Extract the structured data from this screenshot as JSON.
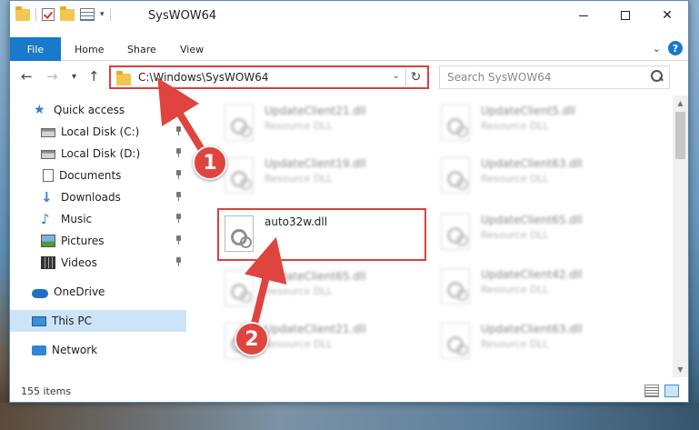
{
  "window": {
    "title": "SysWOW64",
    "controls": {
      "minimize": "—",
      "maximize": "",
      "close": "✕"
    }
  },
  "ribbon": {
    "file": "File",
    "tabs": [
      "Home",
      "Share",
      "View"
    ],
    "help": "?"
  },
  "nav": {
    "back": "←",
    "forward": "→",
    "recent": "▾",
    "up": "↑"
  },
  "address": {
    "path": "C:\\Windows\\SysWOW64",
    "dropdown": "⌄",
    "refresh": "↻"
  },
  "search": {
    "placeholder": "Search SysWOW64"
  },
  "sidebar": {
    "items": [
      {
        "label": "Quick access",
        "icon": "star-icon",
        "pinned": false
      },
      {
        "label": "Local Disk (C:)",
        "icon": "disk-icon",
        "pinned": true
      },
      {
        "label": "Local Disk (D:)",
        "icon": "disk-icon",
        "pinned": true
      },
      {
        "label": "Documents",
        "icon": "documents-icon",
        "pinned": true
      },
      {
        "label": "Downloads",
        "icon": "downloads-icon",
        "pinned": true
      },
      {
        "label": "Music",
        "icon": "music-icon",
        "pinned": true
      },
      {
        "label": "Pictures",
        "icon": "pictures-icon",
        "pinned": true
      },
      {
        "label": "Videos",
        "icon": "videos-icon",
        "pinned": true
      },
      {
        "label": "OneDrive",
        "icon": "onedrive-icon",
        "pinned": false
      },
      {
        "label": "This PC",
        "icon": "this-pc-icon",
        "pinned": false,
        "selected": true
      },
      {
        "label": "Network",
        "icon": "network-icon",
        "pinned": false
      }
    ]
  },
  "files": {
    "left": [
      {
        "name": "UpdateClient21.dll",
        "type": "Resource DLL",
        "blurred": true
      },
      {
        "name": "UpdateClient19.dll",
        "type": "Resource DLL",
        "blurred": true
      },
      {
        "name": "auto32w.dll",
        "type": "",
        "blurred": false
      },
      {
        "name": "UpdateClient65.dll",
        "type": "Resource DLL",
        "blurred": true
      },
      {
        "name": "UpdateClient21.dll",
        "type": "Resource DLL",
        "blurred": true
      }
    ],
    "right": [
      {
        "name": "UpdateClient5.dll",
        "type": "Resource DLL",
        "blurred": true
      },
      {
        "name": "UpdateClient63.dll",
        "type": "Resource DLL",
        "blurred": true
      },
      {
        "name": "UpdateClient65.dll",
        "type": "Resource DLL",
        "blurred": true
      },
      {
        "name": "UpdateClient42.dll",
        "type": "Resource DLL",
        "blurred": true
      },
      {
        "name": "UpdateClient63.dll",
        "type": "Resource DLL",
        "blurred": true
      }
    ]
  },
  "status": {
    "items_count": "155 items"
  },
  "annotations": {
    "step1": "1",
    "step2": "2",
    "color": "#e0443f"
  }
}
